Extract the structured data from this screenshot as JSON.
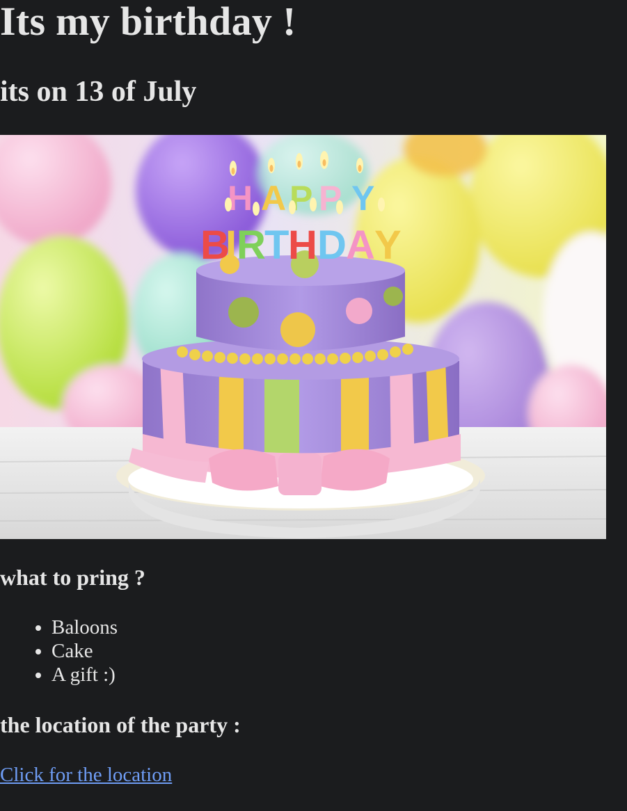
{
  "page": {
    "title": "Its my birthday !",
    "date_line": "its on 13 of July"
  },
  "photo": {
    "subject": "birthday-cake",
    "cake_topper": [
      "HAPPY",
      "BIRTHDAY"
    ],
    "colors": {
      "background": "#1b1c1e",
      "cake_lilac": "#a88fdc",
      "stripe_yellow": "#f2c94a",
      "stripe_green": "#b3d66b",
      "ribbon_pink": "#f6b8d2"
    }
  },
  "bring": {
    "heading": "what to pring ?",
    "items": [
      "Baloons",
      "Cake",
      "A gift :)"
    ]
  },
  "location": {
    "heading": "the location of the party :",
    "link_text": "Click for the location",
    "link_color": "#6f9df5"
  }
}
